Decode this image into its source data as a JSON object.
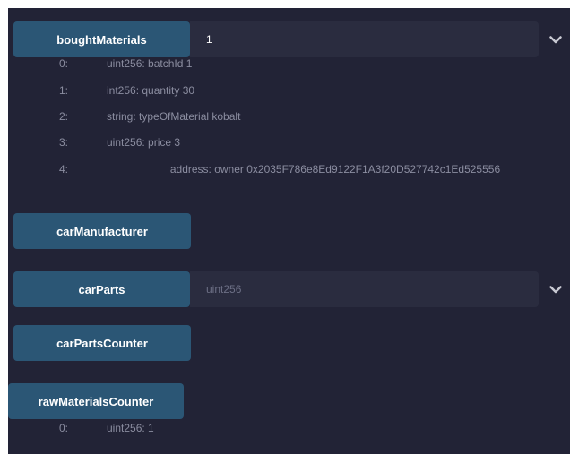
{
  "colors": {
    "panel_bg": "#222336",
    "button_bg": "#2b5675",
    "input_bg": "#2a2c3f",
    "text_muted": "#8b8da0",
    "text_white": "#ffffff"
  },
  "boughtMaterials": {
    "button_label": "boughtMaterials",
    "input_value": "1",
    "expand_icon": "chevron-down-icon",
    "results": [
      {
        "index": "0:",
        "value": "uint256: batchId 1"
      },
      {
        "index": "1:",
        "value": "int256: quantity 30"
      },
      {
        "index": "2:",
        "value": "string: typeOfMaterial kobalt"
      },
      {
        "index": "3:",
        "value": "uint256: price 3"
      },
      {
        "index": "4:",
        "value": "address: owner 0x2035F786e8Ed9122F1A3f20D527742c1Ed525556"
      }
    ]
  },
  "carManufacturer": {
    "button_label": "carManufacturer"
  },
  "carParts": {
    "button_label": "carParts",
    "input_placeholder": "uint256",
    "expand_icon": "chevron-down-icon"
  },
  "carPartsCounter": {
    "button_label": "carPartsCounter"
  },
  "rawMaterialsCounter": {
    "button_label": "rawMaterialsCounter",
    "results": [
      {
        "index": "0:",
        "value": "uint256: 1"
      }
    ]
  }
}
